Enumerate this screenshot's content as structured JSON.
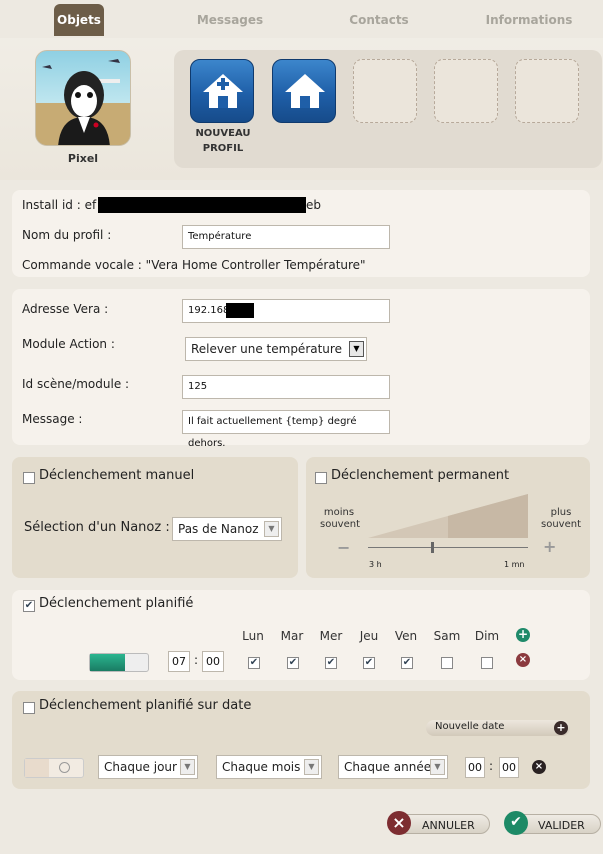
{
  "tabs": [
    {
      "label": "Objets",
      "active": true
    },
    {
      "label": "Messages",
      "active": false
    },
    {
      "label": "Contacts",
      "active": false
    },
    {
      "label": "Informations",
      "active": false
    }
  ],
  "avatar": {
    "name": "Pixel"
  },
  "profiles": {
    "new_profile_label_1": "NOUVEAU",
    "new_profile_label_2": "PROFIL",
    "home_icons": [
      "home-icon",
      "home-icon"
    ]
  },
  "profile": {
    "install_id_label": "Install id :",
    "install_id_prefix": "ef",
    "install_id_suffix": "eb",
    "name_label": "Nom du profil :",
    "name_value": "Température",
    "voice_label": "Commande vocale :",
    "voice_value": "\"Vera Home Controller Température\""
  },
  "vera": {
    "address_label": "Adresse Vera :",
    "address_value": "192.168",
    "module_label": "Module Action :",
    "module_value": "Relever une température",
    "scene_label": "Id scène/module :",
    "scene_value": "125",
    "message_label": "Message :",
    "message_value": "Il fait actuellement {temp} degré dehors."
  },
  "manual": {
    "title": "Déclenchement manuel",
    "checked": false,
    "nanoz_label": "Sélection d'un Nanoz :",
    "nanoz_value": "Pas de Nanoz"
  },
  "permanent": {
    "title": "Déclenchement permanent",
    "checked": false,
    "less_label_1": "moins",
    "less_label_2": "souvent",
    "more_label_1": "plus",
    "more_label_2": "souvent",
    "minus": "−",
    "plus": "+",
    "min_tick": "3 h",
    "max_tick": "1 mn",
    "level": 0.4
  },
  "planned": {
    "title": "Déclenchement planifié",
    "checked": true,
    "hour": "07",
    "minute": "00",
    "sep": ":",
    "days": [
      {
        "label": "Lun",
        "checked": true
      },
      {
        "label": "Mar",
        "checked": true
      },
      {
        "label": "Mer",
        "checked": true
      },
      {
        "label": "Jeu",
        "checked": true
      },
      {
        "label": "Ven",
        "checked": true
      },
      {
        "label": "Sam",
        "checked": false
      },
      {
        "label": "Dim",
        "checked": false
      }
    ]
  },
  "date_planned": {
    "title": "Déclenchement planifié sur date",
    "checked": false,
    "new_date_label": "Nouvelle date",
    "day_select": "Chaque jour",
    "month_select": "Chaque mois",
    "year_select": "Chaque année",
    "hour": "00",
    "minute": "00",
    "sep": ":"
  },
  "actions": {
    "cancel_label": "ANNULER",
    "validate_label": "VALIDER"
  },
  "colors": {
    "accent_blue": "#1f5fa8",
    "tab_active": "#6d5d48",
    "green": "#2a8a6e",
    "danger": "#7a2f32"
  }
}
